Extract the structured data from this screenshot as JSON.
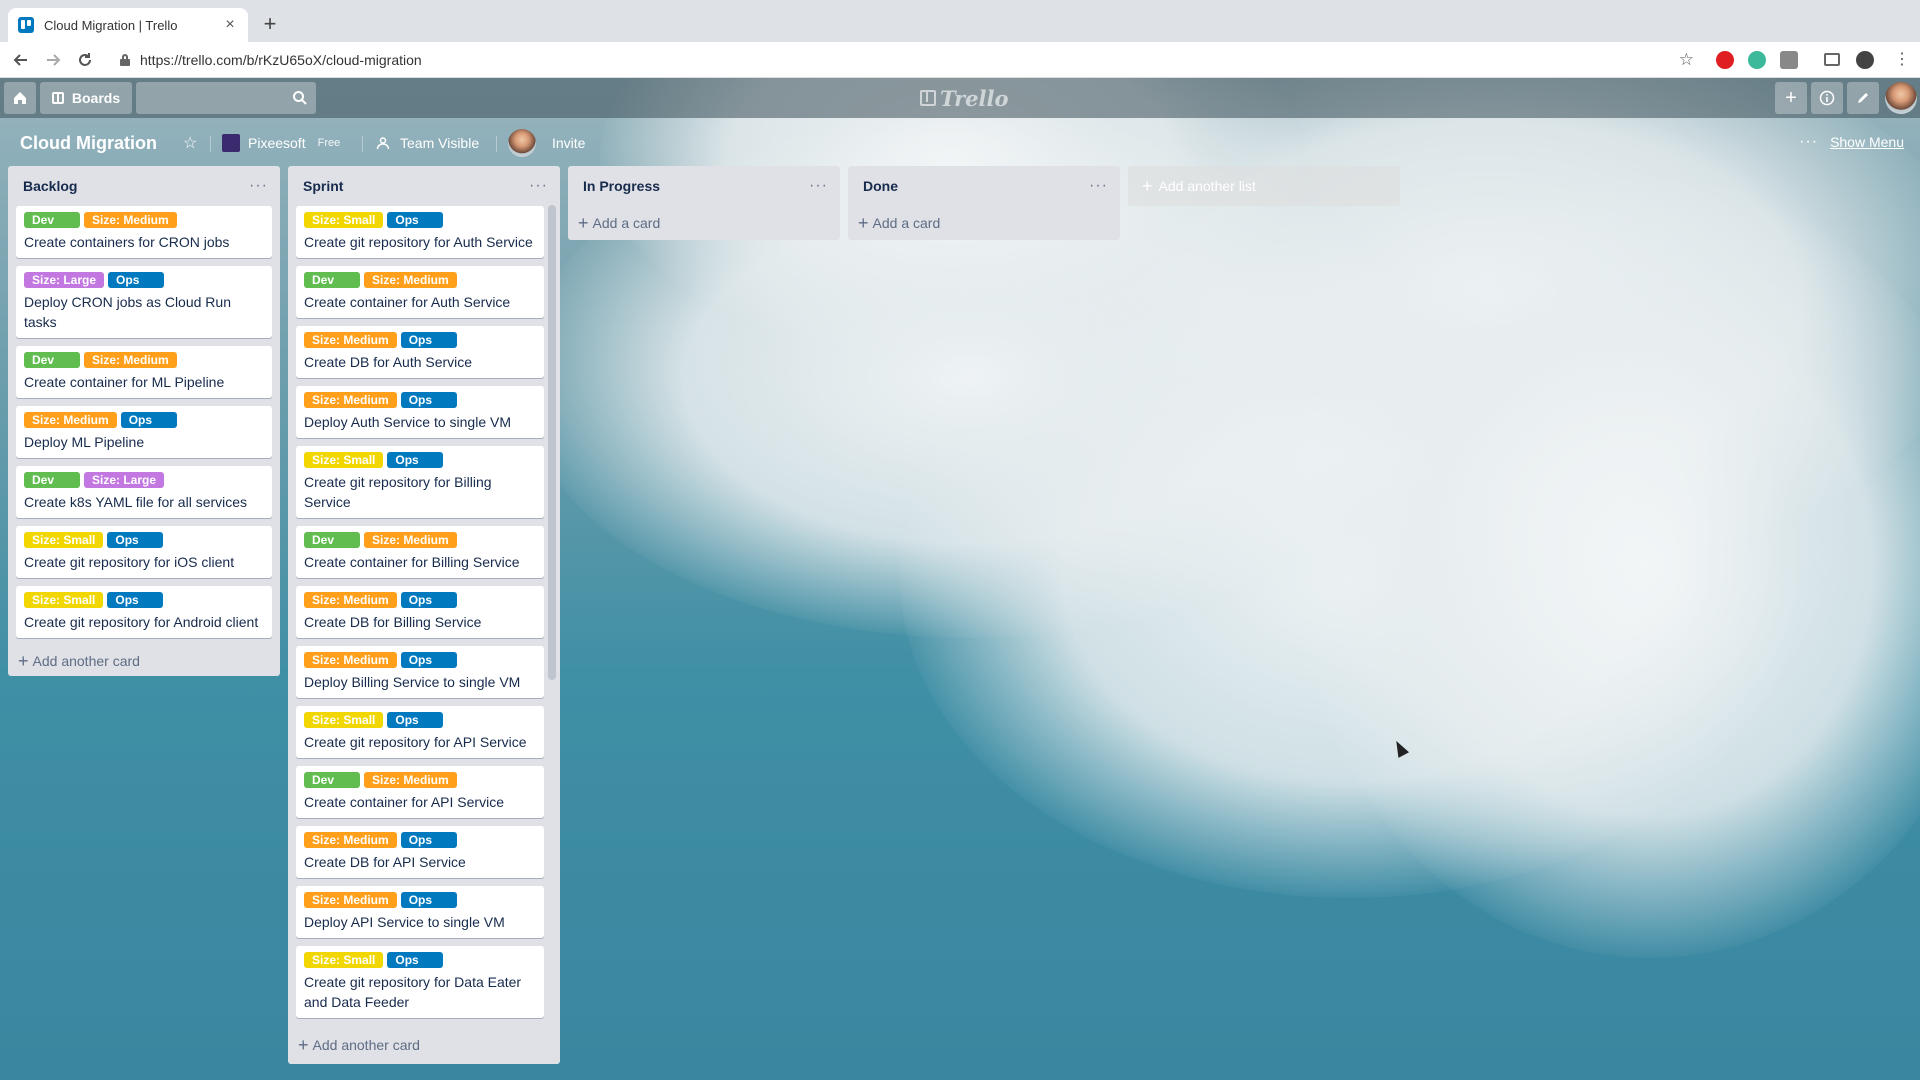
{
  "browser": {
    "tab_title": "Cloud Migration | Trello",
    "tab_close": "×",
    "new_tab": "+",
    "url": "https://trello.com/b/rKzU65oX/cloud-migration",
    "bookmark_star": "☆"
  },
  "header": {
    "boards_label": "Boards",
    "search_value": "",
    "logo_text": "Trello"
  },
  "board": {
    "title": "Cloud Migration",
    "star": "☆",
    "team_name": "Pixeesoft",
    "team_plan": "Free",
    "visibility": "Team Visible",
    "invite": "Invite",
    "menu_dots": "···",
    "show_menu": "Show Menu"
  },
  "label_colors": {
    "green": "#61bd4f",
    "orange": "#ff9f1a",
    "purple": "#c377e0",
    "blue": "#0079bf",
    "yellow": "#f2d600"
  },
  "lists": [
    {
      "title": "Backlog",
      "menu": "···",
      "add_label": "Add another card",
      "cards": [
        {
          "labels": [
            {
              "text": "Dev",
              "color": "green"
            },
            {
              "text": "Size: Medium",
              "color": "orange"
            }
          ],
          "title": "Create containers for CRON jobs"
        },
        {
          "labels": [
            {
              "text": "Size: Large",
              "color": "purple"
            },
            {
              "text": "Ops",
              "color": "blue"
            }
          ],
          "title": "Deploy CRON jobs as Cloud Run tasks"
        },
        {
          "labels": [
            {
              "text": "Dev",
              "color": "green"
            },
            {
              "text": "Size: Medium",
              "color": "orange"
            }
          ],
          "title": "Create container for ML Pipeline"
        },
        {
          "labels": [
            {
              "text": "Size: Medium",
              "color": "orange"
            },
            {
              "text": "Ops",
              "color": "blue"
            }
          ],
          "title": "Deploy ML Pipeline"
        },
        {
          "labels": [
            {
              "text": "Dev",
              "color": "green"
            },
            {
              "text": "Size: Large",
              "color": "purple"
            }
          ],
          "title": "Create k8s YAML file for all services"
        },
        {
          "labels": [
            {
              "text": "Size: Small",
              "color": "yellow"
            },
            {
              "text": "Ops",
              "color": "blue"
            }
          ],
          "title": "Create git repository for iOS client"
        },
        {
          "labels": [
            {
              "text": "Size: Small",
              "color": "yellow"
            },
            {
              "text": "Ops",
              "color": "blue"
            }
          ],
          "title": "Create git repository for Android client"
        }
      ]
    },
    {
      "title": "Sprint",
      "menu": "···",
      "add_label": "Add another card",
      "cards": [
        {
          "labels": [
            {
              "text": "Size: Small",
              "color": "yellow"
            },
            {
              "text": "Ops",
              "color": "blue"
            }
          ],
          "title": "Create git repository for Auth Service"
        },
        {
          "labels": [
            {
              "text": "Dev",
              "color": "green"
            },
            {
              "text": "Size: Medium",
              "color": "orange"
            }
          ],
          "title": "Create container for Auth Service"
        },
        {
          "labels": [
            {
              "text": "Size: Medium",
              "color": "orange"
            },
            {
              "text": "Ops",
              "color": "blue"
            }
          ],
          "title": "Create DB for Auth Service"
        },
        {
          "labels": [
            {
              "text": "Size: Medium",
              "color": "orange"
            },
            {
              "text": "Ops",
              "color": "blue"
            }
          ],
          "title": "Deploy Auth Service to single VM"
        },
        {
          "labels": [
            {
              "text": "Size: Small",
              "color": "yellow"
            },
            {
              "text": "Ops",
              "color": "blue"
            }
          ],
          "title": "Create git repository for Billing Service"
        },
        {
          "labels": [
            {
              "text": "Dev",
              "color": "green"
            },
            {
              "text": "Size: Medium",
              "color": "orange"
            }
          ],
          "title": "Create container for Billing Service"
        },
        {
          "labels": [
            {
              "text": "Size: Medium",
              "color": "orange"
            },
            {
              "text": "Ops",
              "color": "blue"
            }
          ],
          "title": "Create DB for Billing Service"
        },
        {
          "labels": [
            {
              "text": "Size: Medium",
              "color": "orange"
            },
            {
              "text": "Ops",
              "color": "blue"
            }
          ],
          "title": "Deploy Billing Service to single VM"
        },
        {
          "labels": [
            {
              "text": "Size: Small",
              "color": "yellow"
            },
            {
              "text": "Ops",
              "color": "blue"
            }
          ],
          "title": "Create git repository for API Service"
        },
        {
          "labels": [
            {
              "text": "Dev",
              "color": "green"
            },
            {
              "text": "Size: Medium",
              "color": "orange"
            }
          ],
          "title": "Create container for API Service"
        },
        {
          "labels": [
            {
              "text": "Size: Medium",
              "color": "orange"
            },
            {
              "text": "Ops",
              "color": "blue"
            }
          ],
          "title": "Create DB for API Service"
        },
        {
          "labels": [
            {
              "text": "Size: Medium",
              "color": "orange"
            },
            {
              "text": "Ops",
              "color": "blue"
            }
          ],
          "title": "Deploy API Service to single VM"
        },
        {
          "labels": [
            {
              "text": "Size: Small",
              "color": "yellow"
            },
            {
              "text": "Ops",
              "color": "blue"
            }
          ],
          "title": "Create git repository for Data Eater and Data Feeder"
        }
      ]
    },
    {
      "title": "In Progress",
      "menu": "···",
      "add_label": "Add a card",
      "cards": []
    },
    {
      "title": "Done",
      "menu": "···",
      "add_label": "Add a card",
      "cards": []
    }
  ],
  "add_list_label": "Add another list"
}
